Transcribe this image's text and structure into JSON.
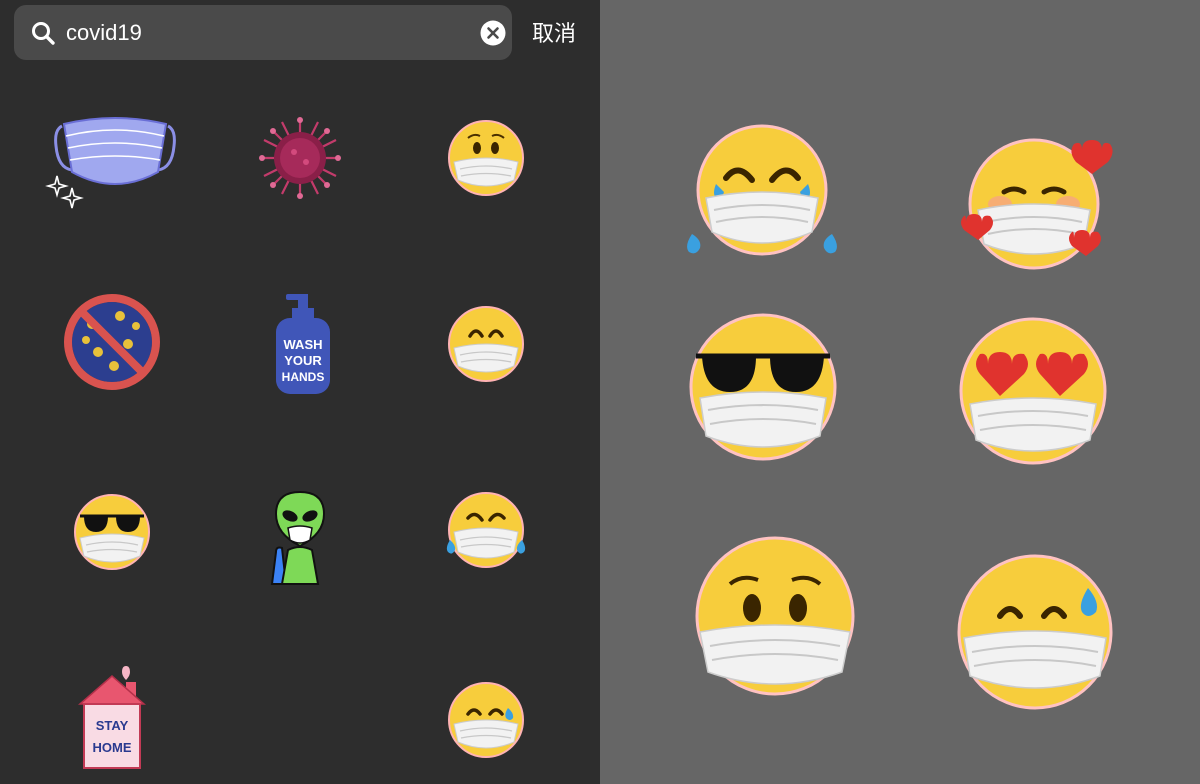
{
  "search": {
    "query": "covid19",
    "cancel_label": "取消"
  },
  "sticker_text": {
    "wash": "WASH",
    "your": "YOUR",
    "hands": "HANDS",
    "stay": "STAY",
    "home": "HOME"
  },
  "left_grid": {
    "items": [
      {
        "icon": "face-mask-icon"
      },
      {
        "icon": "virus-icon"
      },
      {
        "icon": "worried-mask-emoji-icon"
      },
      {
        "icon": "no-virus-icon"
      },
      {
        "icon": "hand-sanitizer-icon"
      },
      {
        "icon": "smiling-mask-emoji-icon"
      },
      {
        "icon": "sunglasses-mask-emoji-icon"
      },
      {
        "icon": "alien-mask-icon"
      },
      {
        "icon": "tears-joy-mask-emoji-icon"
      },
      {
        "icon": "stay-home-house-icon"
      },
      {
        "icon": "sweat-mask-emoji-icon"
      }
    ]
  },
  "right_grid": {
    "items": [
      {
        "icon": "tears-joy-mask-emoji-icon"
      },
      {
        "icon": "hearts-mask-emoji-icon"
      },
      {
        "icon": "sunglasses-mask-emoji-icon"
      },
      {
        "icon": "heart-eyes-mask-emoji-icon"
      },
      {
        "icon": "worried-mask-emoji-icon"
      },
      {
        "icon": "sweat-mask-emoji-icon"
      }
    ]
  },
  "colors": {
    "left_background": "#2d2d2d",
    "search_background": "#4a4a4a",
    "right_background": "#666666",
    "emoji_yellow": "#f7cd3c",
    "mask_white": "#f2f2f2"
  }
}
